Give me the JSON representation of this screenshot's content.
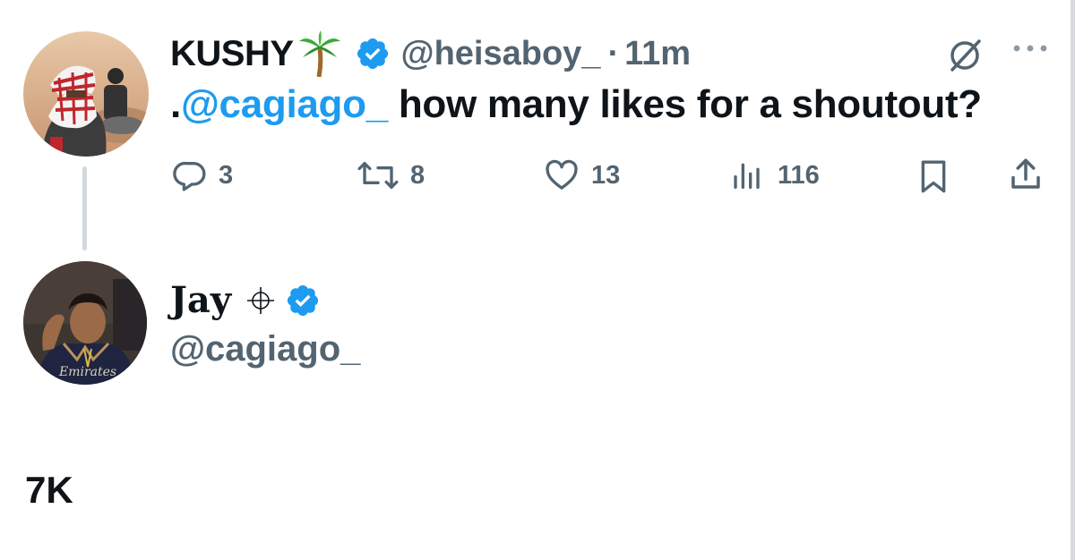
{
  "tweet": {
    "author_name": "KUSHY",
    "name_emoji_icon": "palm-tree-icon",
    "verified_icon": "verified-badge-icon",
    "handle": "@heisaboy_",
    "separator": "·",
    "time": "11m",
    "text_prefix": ".",
    "text_mention": "@cagiago_",
    "text_rest": " how many likes for a shoutout?",
    "actions": {
      "replies": "3",
      "reposts": "8",
      "likes": "13",
      "views": "116"
    }
  },
  "quoted_user": {
    "name": "Jay",
    "name_glyph": "⌖",
    "handle": "@cagiago_"
  },
  "reply": {
    "text": "7K"
  },
  "colors": {
    "accent": "#1d9bf0",
    "secondary_text": "#536471",
    "primary_text": "#0f1419"
  }
}
